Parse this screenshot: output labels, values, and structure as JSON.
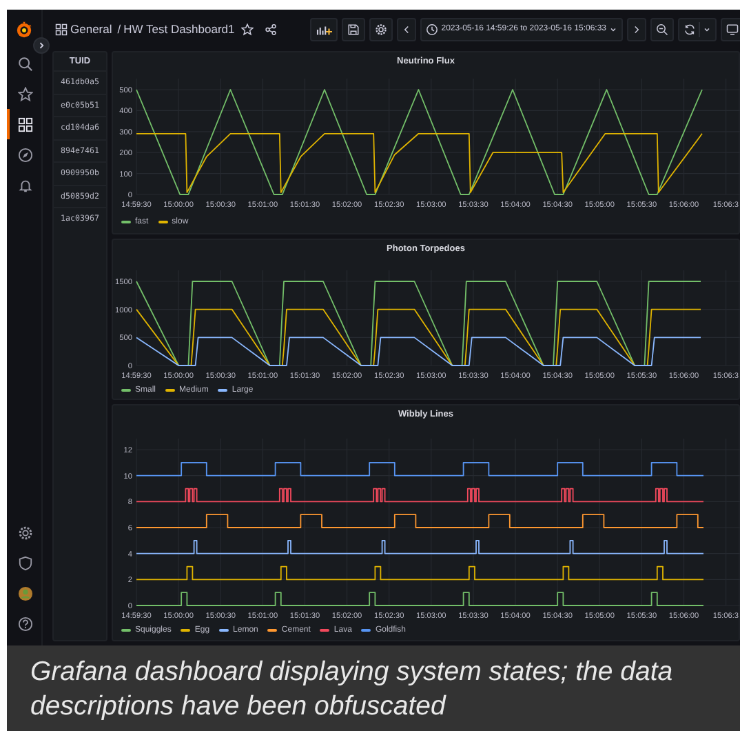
{
  "top_bar": {
    "folder": "General",
    "separator": "/",
    "dashboard": "HW Test Dashboard1",
    "time_range": "2023-05-16 14:59:26 to 2023-05-16 15:06:33"
  },
  "sidebar": {
    "items": [
      {
        "kind": "search",
        "selected": false
      },
      {
        "kind": "starred",
        "selected": false
      },
      {
        "kind": "dashboards",
        "selected": true
      },
      {
        "kind": "explore",
        "selected": false
      },
      {
        "kind": "alerting",
        "selected": false
      }
    ],
    "bottom_items": [
      {
        "kind": "configuration",
        "selected": false
      },
      {
        "kind": "admin",
        "selected": false
      },
      {
        "kind": "profile",
        "selected": false
      },
      {
        "kind": "help",
        "selected": false
      }
    ]
  },
  "tuid_table": {
    "column": "TUID",
    "rows": [
      "461db0a5",
      "e0c05b51",
      "cd104da6",
      "894e7461",
      "0909950b",
      "d50859d2",
      "1ac03967"
    ]
  },
  "panels": [
    {
      "title": "Neutrino Flux",
      "chart_data": {
        "type": "line",
        "grid": true,
        "x": [
          53970,
          54001,
          54005,
          54006,
          54007,
          54020,
          54037,
          54068,
          54072,
          54073,
          54074,
          54087,
          54104,
          54134,
          54139,
          54140,
          54154,
          54171,
          54201,
          54207,
          54208,
          54224,
          54238,
          54268,
          54273,
          54274,
          54304,
          54305,
          54335,
          54341,
          54342,
          54373
        ],
        "series": [
          {
            "name": "fast",
            "color": "#73bf69",
            "values": [
              500,
              0,
              0,
              0,
              0,
              217,
              500,
              0,
              0,
              0,
              0,
              217,
              500,
              0,
              0,
              0,
              226,
              500,
              0,
              0,
              16,
              274,
              500,
              0,
              0,
              0,
              484,
              500,
              0,
              0,
              16,
              500
            ]
          },
          {
            "name": "slow",
            "color": "#e0b400",
            "values": [
              290,
              290,
              290,
              10,
              22,
              180,
              290,
              290,
              290,
              10,
              22,
              180,
              290,
              290,
              290,
              10,
              190,
              290,
              290,
              290,
              10,
              200,
              200,
              200,
              200,
              10,
              290,
              290,
              290,
              290,
              10,
              290
            ]
          }
        ],
        "xlim": [
          53970,
          54400
        ],
        "ylim": [
          0,
          500
        ],
        "xticks": [
          {
            "value": 53970,
            "label": "14:59:30"
          },
          {
            "value": 54000,
            "label": "15:00:00"
          },
          {
            "value": 54030,
            "label": "15:00:30"
          },
          {
            "value": 54060,
            "label": "15:01:00"
          },
          {
            "value": 54090,
            "label": "15:01:30"
          },
          {
            "value": 54120,
            "label": "15:02:00"
          },
          {
            "value": 54150,
            "label": "15:02:30"
          },
          {
            "value": 54180,
            "label": "15:03:00"
          },
          {
            "value": 54210,
            "label": "15:03:30"
          },
          {
            "value": 54240,
            "label": "15:04:00"
          },
          {
            "value": 54270,
            "label": "15:04:30"
          },
          {
            "value": 54300,
            "label": "15:05:00"
          },
          {
            "value": 54330,
            "label": "15:05:30"
          },
          {
            "value": 54360,
            "label": "15:06:00"
          },
          {
            "value": 54390,
            "label": "15:06:3"
          }
        ],
        "yticks": [
          {
            "value": 0,
            "label": "0"
          },
          {
            "value": 100,
            "label": "100"
          },
          {
            "value": 200,
            "label": "200"
          },
          {
            "value": 300,
            "label": "300"
          },
          {
            "value": 400,
            "label": "400"
          },
          {
            "value": 500,
            "label": "500"
          }
        ]
      }
    },
    {
      "title": "Photon Torpedoes",
      "chart_data": {
        "type": "line",
        "grid": true,
        "x": [
          53970,
          54000,
          54007,
          54009,
          54010,
          54012,
          54014,
          54038,
          54065,
          54072,
          54074,
          54075,
          54077,
          54079,
          54103,
          54130,
          54137,
          54139,
          54140,
          54142,
          54144,
          54168,
          54195,
          54202,
          54204,
          54205,
          54207,
          54209,
          54233,
          54260,
          54267,
          54269,
          54270,
          54272,
          54274,
          54298,
          54325,
          54332,
          54334,
          54335,
          54337,
          54339,
          54372
        ],
        "series": [
          {
            "name": "Small",
            "color": "#73bf69",
            "values": [
              1500,
              0,
              0,
              1000,
              1500,
              1500,
              1500,
              1500,
              0,
              0,
              1000,
              1500,
              1500,
              1500,
              1500,
              0,
              0,
              1000,
              1500,
              1500,
              1500,
              1500,
              0,
              0,
              1000,
              1500,
              1500,
              1500,
              1500,
              0,
              0,
              1000,
              1500,
              1500,
              1500,
              1500,
              0,
              0,
              1000,
              1500,
              1500,
              1500,
              1500
            ]
          },
          {
            "name": "Medium",
            "color": "#e0b400",
            "values": [
              1000,
              0,
              0,
              0,
              300,
              1000,
              1000,
              1000,
              0,
              0,
              0,
              300,
              1000,
              1000,
              1000,
              0,
              0,
              0,
              300,
              1000,
              1000,
              1000,
              0,
              0,
              0,
              300,
              1000,
              1000,
              1000,
              0,
              0,
              0,
              300,
              1000,
              1000,
              1000,
              0,
              0,
              0,
              300,
              1000,
              1000,
              1000
            ]
          },
          {
            "name": "Large",
            "color": "#8ab8ff",
            "values": [
              500,
              0,
              0,
              0,
              0,
              0,
              500,
              500,
              0,
              0,
              0,
              0,
              0,
              500,
              500,
              0,
              0,
              0,
              0,
              0,
              500,
              500,
              0,
              0,
              0,
              0,
              0,
              500,
              500,
              0,
              0,
              0,
              0,
              0,
              500,
              500,
              0,
              0,
              0,
              0,
              0,
              500,
              500
            ]
          }
        ],
        "xlim": [
          53970,
          54400
        ],
        "ylim": [
          0,
          1500
        ],
        "xticks": [
          {
            "value": 53970,
            "label": "14:59:30"
          },
          {
            "value": 54000,
            "label": "15:00:00"
          },
          {
            "value": 54030,
            "label": "15:00:30"
          },
          {
            "value": 54060,
            "label": "15:01:00"
          },
          {
            "value": 54090,
            "label": "15:01:30"
          },
          {
            "value": 54120,
            "label": "15:02:00"
          },
          {
            "value": 54150,
            "label": "15:02:30"
          },
          {
            "value": 54180,
            "label": "15:03:00"
          },
          {
            "value": 54210,
            "label": "15:03:30"
          },
          {
            "value": 54240,
            "label": "15:04:00"
          },
          {
            "value": 54270,
            "label": "15:04:30"
          },
          {
            "value": 54300,
            "label": "15:05:00"
          },
          {
            "value": 54330,
            "label": "15:05:30"
          },
          {
            "value": 54360,
            "label": "15:06:00"
          },
          {
            "value": 54390,
            "label": "15:06:3"
          }
        ],
        "yticks": [
          {
            "value": 0,
            "label": "0"
          },
          {
            "value": 500,
            "label": "500"
          },
          {
            "value": 1000,
            "label": "1000"
          },
          {
            "value": 1500,
            "label": "1500"
          }
        ]
      }
    },
    {
      "title": "Wibbly Lines",
      "chart_data": {
        "type": "line",
        "grid": true,
        "x": [
          53970,
          54002,
          54002,
          54005,
          54005,
          54006,
          54006,
          54007,
          54007,
          54008,
          54008,
          54010,
          54010,
          54011,
          54011,
          54013,
          54013,
          54020,
          54020,
          54035,
          54035,
          54069,
          54069,
          54072,
          54072,
          54073,
          54073,
          54074,
          54074,
          54075,
          54075,
          54077,
          54077,
          54078,
          54078,
          54080,
          54080,
          54087,
          54087,
          54102,
          54102,
          54136,
          54136,
          54139,
          54139,
          54140,
          54140,
          54141,
          54141,
          54142,
          54142,
          54144,
          54144,
          54145,
          54145,
          54147,
          54147,
          54154,
          54154,
          54169,
          54169,
          54203,
          54203,
          54206,
          54206,
          54207,
          54207,
          54208,
          54208,
          54209,
          54209,
          54211,
          54211,
          54212,
          54212,
          54214,
          54214,
          54221,
          54221,
          54236,
          54236,
          54270,
          54270,
          54273,
          54273,
          54274,
          54274,
          54275,
          54275,
          54276,
          54276,
          54278,
          54278,
          54279,
          54279,
          54281,
          54281,
          54288,
          54288,
          54303,
          54303,
          54337,
          54337,
          54340,
          54340,
          54341,
          54341,
          54342,
          54342,
          54343,
          54343,
          54345,
          54345,
          54346,
          54346,
          54348,
          54348,
          54355,
          54355,
          54370,
          54370,
          54374
        ],
        "series": [
          {
            "name": "Squiggles",
            "color": "#73bf69",
            "values": [
              0,
              0,
              1,
              1,
              1,
              1,
              0,
              0,
              0,
              0,
              0,
              0,
              0,
              0,
              0,
              0,
              0,
              0,
              0,
              0,
              0,
              0,
              1,
              1,
              1,
              1,
              0,
              0,
              0,
              0,
              0,
              0,
              0,
              0,
              0,
              0,
              0,
              0,
              0,
              0,
              0,
              0,
              1,
              1,
              1,
              1,
              0,
              0,
              0,
              0,
              0,
              0,
              0,
              0,
              0,
              0,
              0,
              0,
              0,
              0,
              0,
              0,
              1,
              1,
              1,
              1,
              0,
              0,
              0,
              0,
              0,
              0,
              0,
              0,
              0,
              0,
              0,
              0,
              0,
              0,
              0,
              0,
              1,
              1,
              1,
              1,
              0,
              0,
              0,
              0,
              0,
              0,
              0,
              0,
              0,
              0,
              0,
              0,
              0,
              0,
              0,
              0,
              1,
              1,
              1,
              1,
              0,
              0,
              0,
              0,
              0,
              0,
              0,
              0,
              0,
              0,
              0,
              0,
              0,
              0,
              0,
              0
            ]
          },
          {
            "name": "Egg",
            "color": "#e0b400",
            "values": [
              2,
              2,
              2,
              2,
              2,
              2,
              3,
              3,
              3,
              3,
              3,
              3,
              2,
              2,
              2,
              2,
              2,
              2,
              2,
              2,
              2,
              2,
              2,
              2,
              2,
              2,
              3,
              3,
              3,
              3,
              3,
              3,
              2,
              2,
              2,
              2,
              2,
              2,
              2,
              2,
              2,
              2,
              2,
              2,
              2,
              2,
              3,
              3,
              3,
              3,
              3,
              3,
              2,
              2,
              2,
              2,
              2,
              2,
              2,
              2,
              2,
              2,
              2,
              2,
              2,
              2,
              3,
              3,
              3,
              3,
              3,
              3,
              2,
              2,
              2,
              2,
              2,
              2,
              2,
              2,
              2,
              2,
              2,
              2,
              2,
              2,
              3,
              3,
              3,
              3,
              3,
              3,
              2,
              2,
              2,
              2,
              2,
              2,
              2,
              2,
              2,
              2,
              2,
              2,
              2,
              2,
              3,
              3,
              3,
              3,
              3,
              3,
              2,
              2,
              2,
              2,
              2,
              2,
              2,
              2,
              2,
              2
            ]
          },
          {
            "name": "Lemon",
            "color": "#8ab8ff",
            "values": [
              4,
              4,
              4,
              4,
              4,
              4,
              4,
              4,
              4,
              4,
              4,
              4,
              4,
              4,
              5,
              5,
              4,
              4,
              4,
              4,
              4,
              4,
              4,
              4,
              4,
              4,
              4,
              4,
              4,
              4,
              4,
              4,
              4,
              4,
              5,
              5,
              4,
              4,
              4,
              4,
              4,
              4,
              4,
              4,
              4,
              4,
              4,
              4,
              4,
              4,
              4,
              4,
              4,
              4,
              5,
              5,
              4,
              4,
              4,
              4,
              4,
              4,
              4,
              4,
              4,
              4,
              4,
              4,
              4,
              4,
              4,
              4,
              4,
              4,
              5,
              5,
              4,
              4,
              4,
              4,
              4,
              4,
              4,
              4,
              4,
              4,
              4,
              4,
              4,
              4,
              4,
              4,
              4,
              4,
              5,
              5,
              4,
              4,
              4,
              4,
              4,
              4,
              4,
              4,
              4,
              4,
              4,
              4,
              4,
              4,
              4,
              4,
              4,
              4,
              5,
              5,
              4,
              4,
              4,
              4,
              4,
              4
            ]
          },
          {
            "name": "Cement",
            "color": "#ff9830",
            "values": [
              6,
              6,
              6,
              6,
              6,
              6,
              6,
              6,
              6,
              6,
              6,
              6,
              6,
              6,
              6,
              6,
              6,
              6,
              7,
              7,
              6,
              6,
              6,
              6,
              6,
              6,
              6,
              6,
              6,
              6,
              6,
              6,
              6,
              6,
              6,
              6,
              6,
              6,
              7,
              7,
              6,
              6,
              6,
              6,
              6,
              6,
              6,
              6,
              6,
              6,
              6,
              6,
              6,
              6,
              6,
              6,
              6,
              6,
              7,
              7,
              6,
              6,
              6,
              6,
              6,
              6,
              6,
              6,
              6,
              6,
              6,
              6,
              6,
              6,
              6,
              6,
              6,
              6,
              7,
              7,
              6,
              6,
              6,
              6,
              6,
              6,
              6,
              6,
              6,
              6,
              6,
              6,
              6,
              6,
              6,
              6,
              6,
              6,
              7,
              7,
              6,
              6,
              6,
              6,
              6,
              6,
              6,
              6,
              6,
              6,
              6,
              6,
              6,
              6,
              6,
              6,
              6,
              6,
              7,
              7,
              6,
              6
            ]
          },
          {
            "name": "Lava",
            "color": "#f2495c",
            "values": [
              8,
              8,
              8,
              8,
              9,
              9,
              9,
              9,
              8,
              8,
              9,
              9,
              8,
              8,
              9,
              9,
              8,
              8,
              8,
              8,
              8,
              8,
              8,
              8,
              9,
              9,
              9,
              9,
              8,
              8,
              9,
              9,
              8,
              8,
              9,
              9,
              8,
              8,
              8,
              8,
              8,
              8,
              8,
              8,
              9,
              9,
              9,
              9,
              8,
              8,
              9,
              9,
              8,
              8,
              9,
              9,
              8,
              8,
              8,
              8,
              8,
              8,
              8,
              8,
              9,
              9,
              9,
              9,
              8,
              8,
              9,
              9,
              8,
              8,
              9,
              9,
              8,
              8,
              8,
              8,
              8,
              8,
              8,
              8,
              9,
              9,
              9,
              9,
              8,
              8,
              9,
              9,
              8,
              8,
              9,
              9,
              8,
              8,
              8,
              8,
              8,
              8,
              8,
              8,
              9,
              9,
              9,
              9,
              8,
              8,
              9,
              9,
              8,
              8,
              9,
              9,
              8,
              8,
              8,
              8,
              8,
              8
            ]
          },
          {
            "name": "Goldfish",
            "color": "#5794f2",
            "values": [
              10,
              10,
              11,
              11,
              11,
              11,
              11,
              11,
              11,
              11,
              11,
              11,
              11,
              11,
              11,
              11,
              11,
              11,
              10,
              10,
              10,
              10,
              11,
              11,
              11,
              11,
              11,
              11,
              11,
              11,
              11,
              11,
              11,
              11,
              11,
              11,
              11,
              11,
              10,
              10,
              10,
              10,
              11,
              11,
              11,
              11,
              11,
              11,
              11,
              11,
              11,
              11,
              11,
              11,
              11,
              11,
              11,
              11,
              10,
              10,
              10,
              10,
              11,
              11,
              11,
              11,
              11,
              11,
              11,
              11,
              11,
              11,
              11,
              11,
              11,
              11,
              11,
              11,
              10,
              10,
              10,
              10,
              11,
              11,
              11,
              11,
              11,
              11,
              11,
              11,
              11,
              11,
              11,
              11,
              11,
              11,
              11,
              11,
              10,
              10,
              10,
              10,
              11,
              11,
              11,
              11,
              11,
              11,
              11,
              11,
              11,
              11,
              11,
              11,
              11,
              11,
              11,
              11,
              10,
              10,
              10,
              10
            ]
          }
        ],
        "xlim": [
          53970,
          54400
        ],
        "ylim": [
          0,
          12
        ],
        "xticks": [
          {
            "value": 53970,
            "label": "14:59:30"
          },
          {
            "value": 54000,
            "label": "15:00:00"
          },
          {
            "value": 54030,
            "label": "15:00:30"
          },
          {
            "value": 54060,
            "label": "15:01:00"
          },
          {
            "value": 54090,
            "label": "15:01:30"
          },
          {
            "value": 54120,
            "label": "15:02:00"
          },
          {
            "value": 54150,
            "label": "15:02:30"
          },
          {
            "value": 54180,
            "label": "15:03:00"
          },
          {
            "value": 54210,
            "label": "15:03:30"
          },
          {
            "value": 54240,
            "label": "15:04:00"
          },
          {
            "value": 54270,
            "label": "15:04:30"
          },
          {
            "value": 54300,
            "label": "15:05:00"
          },
          {
            "value": 54330,
            "label": "15:05:30"
          },
          {
            "value": 54360,
            "label": "15:06:00"
          },
          {
            "value": 54390,
            "label": "15:06:3"
          }
        ],
        "yticks": [
          {
            "value": 0,
            "label": "0"
          },
          {
            "value": 2,
            "label": "2"
          },
          {
            "value": 4,
            "label": "4"
          },
          {
            "value": 6,
            "label": "6"
          },
          {
            "value": 8,
            "label": "8"
          },
          {
            "value": 10,
            "label": "10"
          },
          {
            "value": 12,
            "label": "12"
          }
        ]
      }
    }
  ],
  "caption": "Grafana dashboard displaying system states; the data descriptions have been obfuscated"
}
